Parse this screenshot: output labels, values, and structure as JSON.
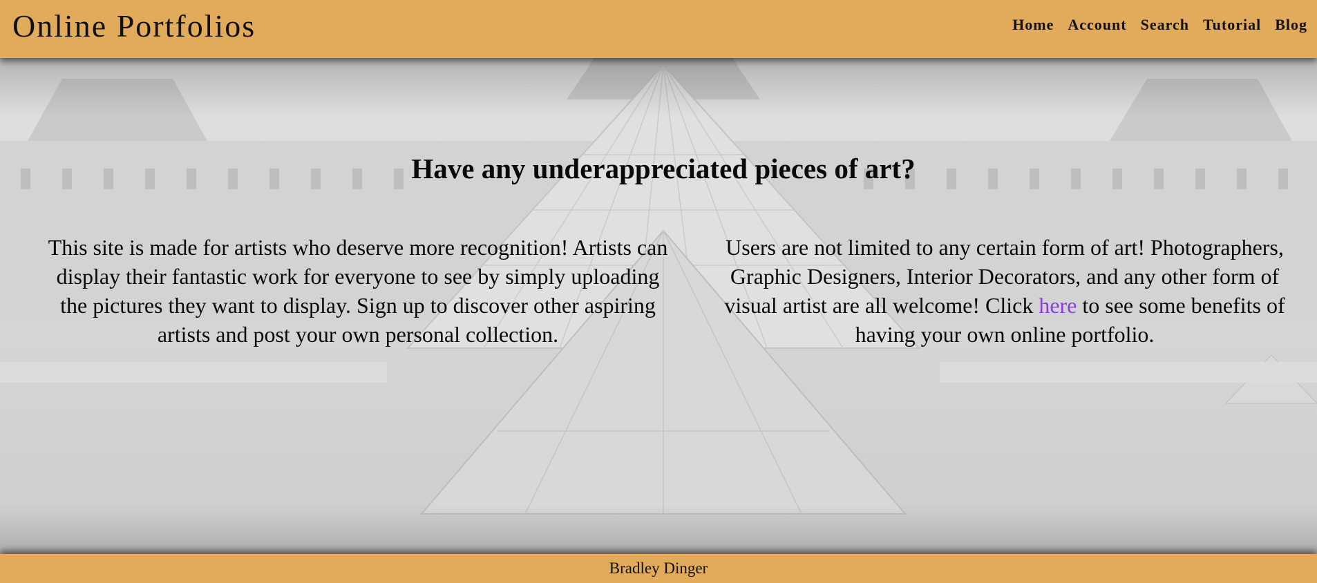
{
  "header": {
    "title": "Online Portfolios",
    "nav": [
      {
        "label": "Home"
      },
      {
        "label": "Account"
      },
      {
        "label": "Search"
      },
      {
        "label": "Tutorial"
      },
      {
        "label": "Blog"
      }
    ]
  },
  "main": {
    "headline": "Have any underappreciated pieces of art?",
    "left_paragraph": "This site is made for artists who deserve more recognition! Artists can display their fantastic work for everyone to see by simply uploading the pictures they want to display. Sign up to discover other aspiring artists and post your own personal collection.",
    "right_paragraph": {
      "before_link": "Users are not limited to any certain form of art! Photographers, Graphic Designers, Interior Decorators, and any other form of visual artist are all welcome! Click ",
      "link_text": "here",
      "after_link": " to see some benefits of having your own online portfolio."
    }
  },
  "footer": {
    "author": "Bradley Dinger"
  },
  "colors": {
    "header_bg": "#e2ab5c",
    "footer_bg": "#e2ab5c",
    "link": "#8a3fd6",
    "text": "#0a0a0a"
  }
}
